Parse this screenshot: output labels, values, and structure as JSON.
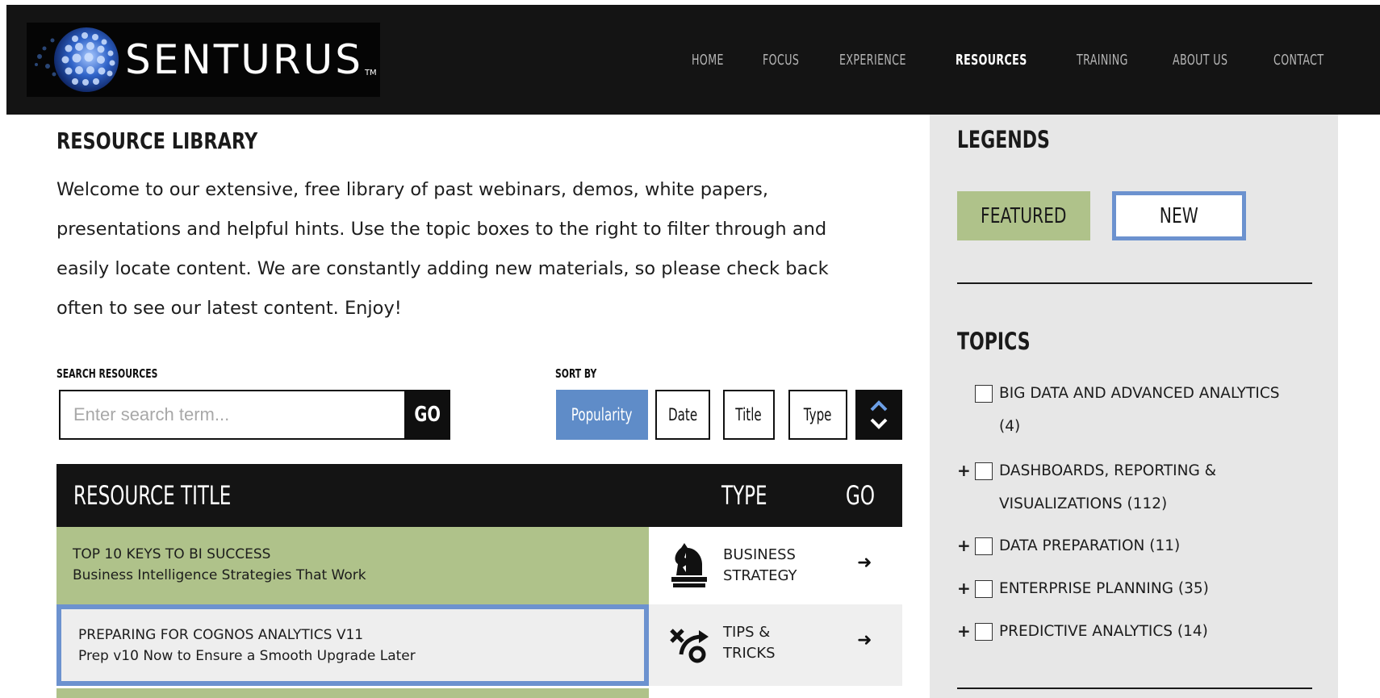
{
  "brand": {
    "name": "SENTURUS",
    "tm": "TM"
  },
  "nav": [
    {
      "label": "HOME"
    },
    {
      "label": "FOCUS"
    },
    {
      "label": "EXPERIENCE"
    },
    {
      "label": "RESOURCES",
      "active": true
    },
    {
      "label": "TRAINING"
    },
    {
      "label": "ABOUT US"
    },
    {
      "label": "CONTACT"
    }
  ],
  "main": {
    "title": "RESOURCE LIBRARY",
    "intro_lines": [
      "Welcome to our extensive, free library of past webinars, demos, white papers,",
      "presentations and helpful hints. Use the topic boxes to the right to filter through and",
      "easily locate content. We are constantly adding new materials, so please check back",
      "often to see our latest content. Enjoy!"
    ],
    "search": {
      "label": "SEARCH RESOURCES",
      "placeholder": "Enter search term...",
      "go": "GO"
    },
    "sort": {
      "label": "SORT BY",
      "options": [
        "Popularity",
        "Date",
        "Title",
        "Type"
      ],
      "active": "Popularity"
    }
  },
  "table": {
    "headers": {
      "title": "RESOURCE TITLE",
      "type": "TYPE",
      "go": "GO"
    },
    "rows": [
      {
        "title": "TOP 10 KEYS TO BI SUCCESS",
        "subtitle": "Business Intelligence Strategies That Work",
        "type_line1": "BUSINESS",
        "type_line2": "STRATEGY",
        "icon": "chess-knight-icon",
        "status": "featured"
      },
      {
        "title": "PREPARING FOR COGNOS ANALYTICS V11",
        "subtitle": "Prep v10 Now to Ensure a Smooth Upgrade Later",
        "type_line1": "TIPS &",
        "type_line2": "TRICKS",
        "icon": "tips-tricks-icon",
        "status": "new"
      }
    ]
  },
  "sidebar": {
    "legends_title": "LEGENDS",
    "legend_featured": "FEATURED",
    "legend_new": "NEW",
    "topics_title": "TOPICS",
    "topics": [
      {
        "line1": "BIG DATA AND ADVANCED ANALYTICS",
        "line2": "(4)",
        "expandable": false
      },
      {
        "line1": "DASHBOARDS, REPORTING &",
        "line2": "VISUALIZATIONS (112)",
        "expandable": true
      },
      {
        "line1": "DATA PREPARATION (11)",
        "expandable": true
      },
      {
        "line1": "ENTERPRISE PLANNING (35)",
        "expandable": true
      },
      {
        "line1": "PREDICTIVE ANALYTICS (14)",
        "expandable": true
      }
    ]
  },
  "colors": {
    "featured": "#afc28a",
    "new_border": "#6c92cf",
    "active_sort": "#5f8cc8",
    "header_bg": "#141414"
  }
}
